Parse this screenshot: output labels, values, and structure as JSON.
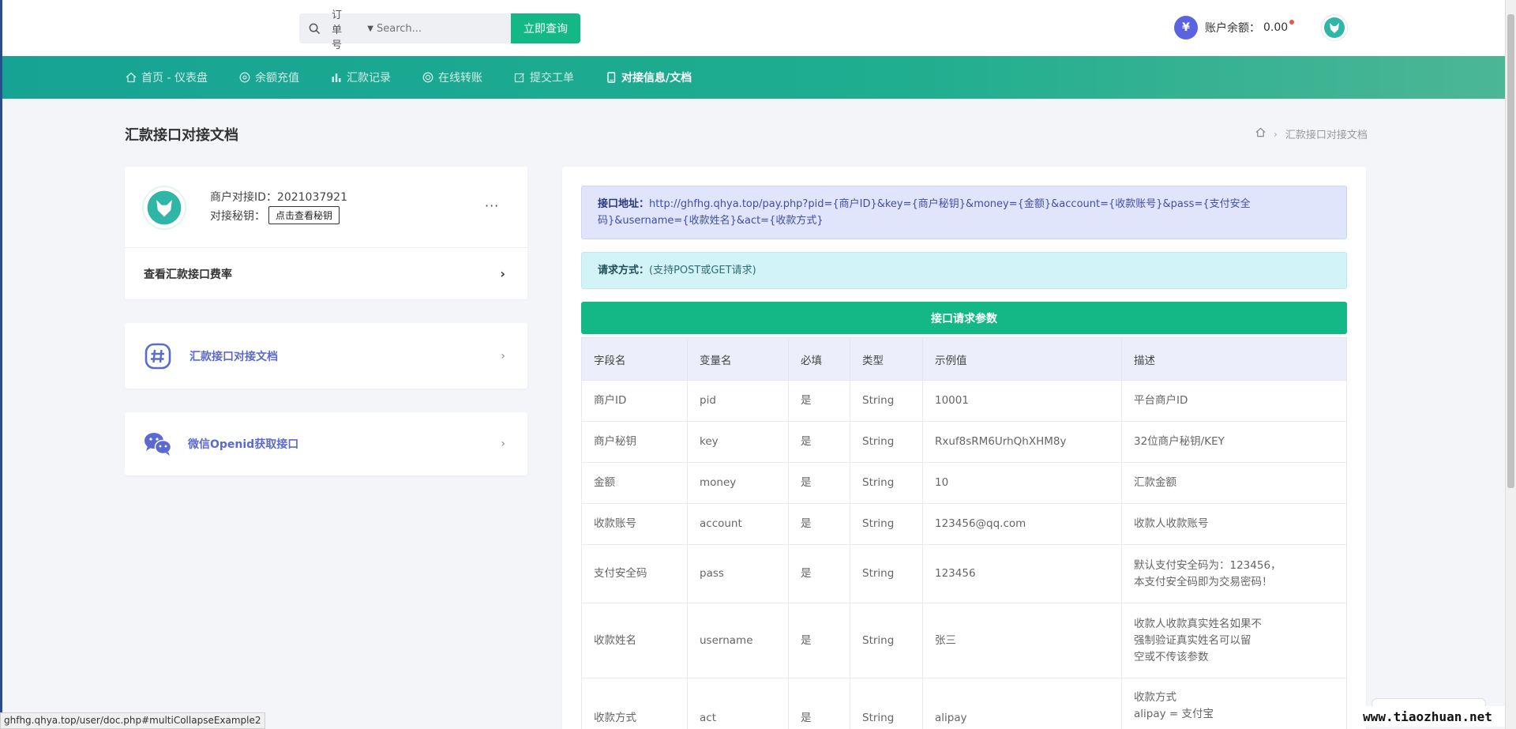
{
  "topbar": {
    "search_type": "订单号",
    "search_placeholder": "Search...",
    "search_button": "立即查询",
    "currency_symbol": "¥",
    "balance_label": "账户余额：",
    "balance_value": "0.00"
  },
  "nav": {
    "items": [
      {
        "label": "首页 - 仪表盘",
        "icon": "home-icon"
      },
      {
        "label": "余额充值",
        "icon": "coin-icon"
      },
      {
        "label": "汇款记录",
        "icon": "bar-chart-icon"
      },
      {
        "label": "在线转账",
        "icon": "transfer-icon"
      },
      {
        "label": "提交工单",
        "icon": "edit-icon"
      },
      {
        "label": "对接信息/文档",
        "icon": "document-icon",
        "active": true
      }
    ]
  },
  "page": {
    "title": "汇款接口对接文档",
    "breadcrumb_current": "汇款接口对接文档"
  },
  "profile": {
    "merchant_id_label": "商户对接ID：",
    "merchant_id": "2021037921",
    "secret_label": "对接秘钥：",
    "secret_button": "点击查看秘钥",
    "more": "···",
    "rate_link": "查看汇款接口费率"
  },
  "links": [
    {
      "label": "汇款接口对接文档",
      "icon": "hashtag-icon"
    },
    {
      "label": "微信Openid获取接口",
      "icon": "wechat-icon"
    }
  ],
  "doc": {
    "api_url_label": "接口地址：",
    "api_url": "http://ghfhg.qhya.top/pay.php?pid={商户ID}&key={商户秘钥}&money={金额}&account={收款账号}&pass={支付安全码}&username={收款姓名}&act={收款方式}",
    "method_label": "请求方式：",
    "method_value": "(支持POST或GET请求)",
    "params_title": "接口请求参数",
    "columns": [
      "字段名",
      "变量名",
      "必填",
      "类型",
      "示例值",
      "描述"
    ],
    "rows": [
      {
        "field": "商户ID",
        "var": "pid",
        "required": "是",
        "type": "String",
        "example": "10001",
        "desc": [
          "平台商户ID"
        ]
      },
      {
        "field": "商户秘钥",
        "var": "key",
        "required": "是",
        "type": "String",
        "example": "Rxuf8sRM6UrhQhXHM8y",
        "desc": [
          "32位商户秘钥/KEY"
        ]
      },
      {
        "field": "金额",
        "var": "money",
        "required": "是",
        "type": "String",
        "example": "10",
        "desc": [
          "汇款金额"
        ]
      },
      {
        "field": "收款账号",
        "var": "account",
        "required": "是",
        "type": "String",
        "example": "123456@qq.com",
        "desc": [
          "收款人收款账号"
        ]
      },
      {
        "field": "支付安全码",
        "var": "pass",
        "required": "是",
        "type": "String",
        "example": "123456",
        "desc": [
          "默认支付安全码为：123456，",
          "本支付安全码即为交易密码！"
        ]
      },
      {
        "field": "收款姓名",
        "var": "username",
        "required": "是",
        "type": "String",
        "example": "张三",
        "desc": [
          "收款人收款真实姓名如果不",
          "强制验证真实姓名可以留",
          "空或不传该参数"
        ]
      },
      {
        "field": "收款方式",
        "var": "act",
        "required": "是",
        "type": "String",
        "example": "alipay",
        "desc": [
          "收款方式",
          "alipay = 支付宝"
        ]
      }
    ]
  },
  "status_url": "ghfhg.qhya.top/user/doc.php#multiCollapseExample2",
  "watermark": "www.tiaozhuan.net",
  "colors": {
    "accent": "#13b886",
    "nav_start": "#17a394",
    "nav_end": "#4cb695",
    "link": "#5b6ad0",
    "info_bg": "#e0e5fb",
    "cyan_bg": "#d2f3f7"
  }
}
